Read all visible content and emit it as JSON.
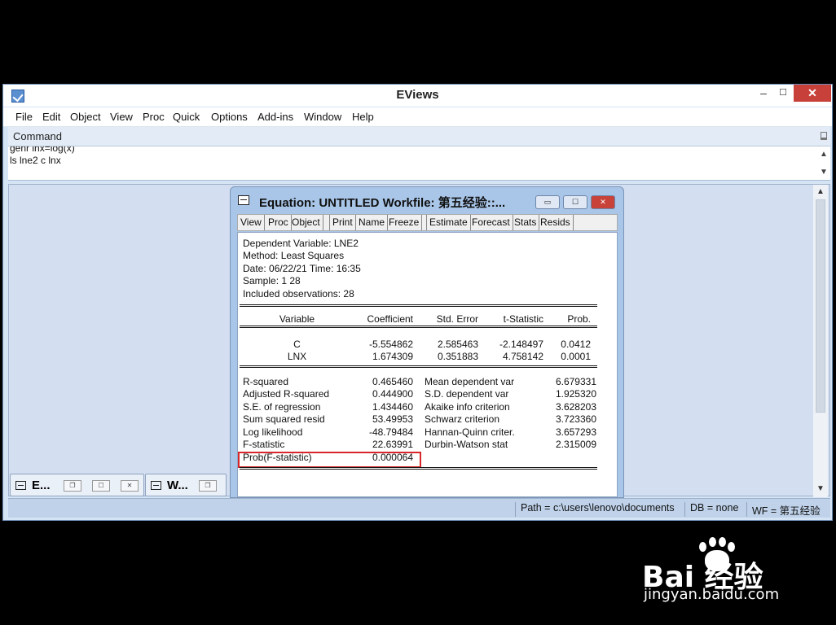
{
  "window": {
    "title": "EViews",
    "min": "–",
    "max": "☐",
    "close": "✕"
  },
  "menu": [
    "File",
    "Edit",
    "Object",
    "View",
    "Proc",
    "Quick",
    "Options",
    "Add-ins",
    "Window",
    "Help"
  ],
  "command": {
    "title": "Command",
    "lines": [
      "genr lnx=log(x)",
      "ls lne2 c lnx"
    ]
  },
  "minimized": [
    {
      "label": "E..."
    },
    {
      "label": "W..."
    }
  ],
  "status": {
    "path": "Path = c:\\users\\lenovo\\documents",
    "db": "DB = none",
    "wf": "WF = 第五经验"
  },
  "equation": {
    "title": "Equation: UNTITLED   Workfile: 第五经验::...",
    "toolbar": [
      "View",
      "Proc",
      "Object",
      "Print",
      "Name",
      "Freeze",
      "Estimate",
      "Forecast",
      "Stats",
      "Resids"
    ],
    "header": [
      "Dependent Variable: LNE2",
      "Method: Least Squares",
      "Date: 06/22/21   Time: 16:35",
      "Sample: 1 28",
      "Included observations: 28"
    ],
    "columns": [
      "Variable",
      "Coefficient",
      "Std. Error",
      "t-Statistic",
      "Prob."
    ],
    "rows": [
      [
        "C",
        "-5.554862",
        "2.585463",
        "-2.148497",
        "0.0412"
      ],
      [
        "LNX",
        "1.674309",
        "0.351883",
        "4.758142",
        "0.0001"
      ]
    ],
    "stats": [
      [
        "R-squared",
        "0.465460",
        "Mean dependent var",
        "6.679331"
      ],
      [
        "Adjusted R-squared",
        "0.444900",
        "S.D. dependent var",
        "1.925320"
      ],
      [
        "S.E. of regression",
        "1.434460",
        "Akaike info criterion",
        "3.628203"
      ],
      [
        "Sum squared resid",
        "53.49953",
        "Schwarz criterion",
        "3.723360"
      ],
      [
        "Log likelihood",
        "-48.79484",
        "Hannan-Quinn criter.",
        "3.657293"
      ],
      [
        "F-statistic",
        "22.63991",
        "Durbin-Watson stat",
        "2.315009"
      ],
      [
        "Prob(F-statistic)",
        "0.000064",
        "",
        ""
      ]
    ]
  },
  "watermark": {
    "brand": "Bai  经验",
    "url": "jingyan.baidu.com"
  }
}
